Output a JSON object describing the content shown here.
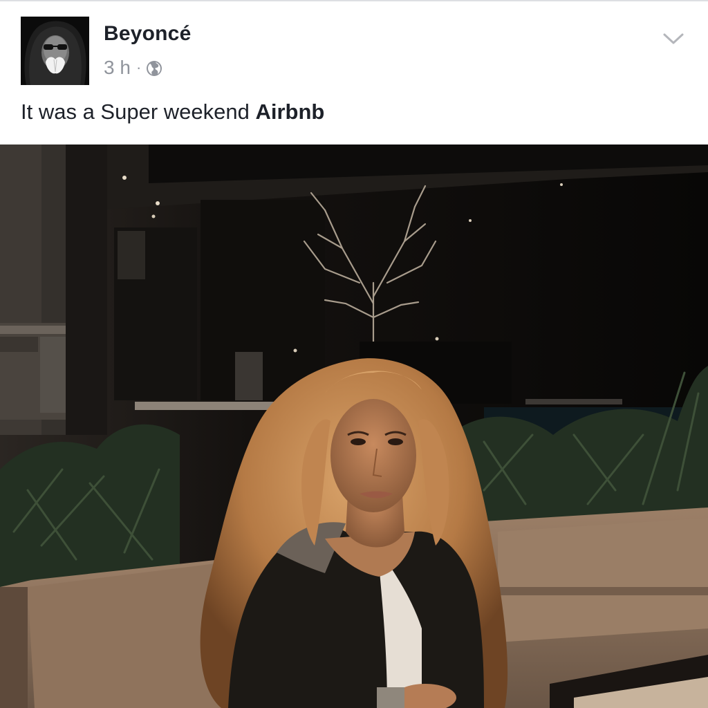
{
  "post": {
    "author": "Beyoncé",
    "timestamp": "3 h",
    "separator": "·",
    "privacy_icon": "globe-icon",
    "options_icon": "chevron-down-icon",
    "caption_text": "It was a Super weekend ",
    "caption_tag": "Airbnb"
  },
  "colors": {
    "text_primary": "#1d2129",
    "text_secondary": "#90949c",
    "background": "#ffffff"
  }
}
